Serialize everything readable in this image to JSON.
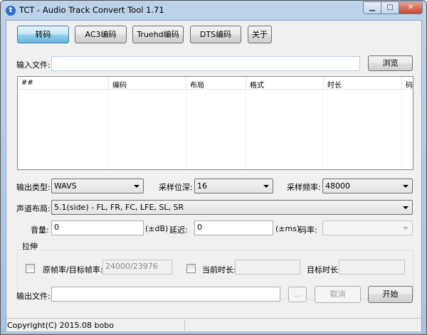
{
  "window": {
    "title": "TCT - Audio Track Convert Tool 1.71",
    "minimize_icon": "minimize-icon",
    "maximize_icon": "maximize-icon",
    "close_icon": "close-icon",
    "app_icon_letter": "t"
  },
  "tabs": [
    {
      "label": "转码",
      "active": true
    },
    {
      "label": "AC3编码"
    },
    {
      "label": "Truehd编码"
    },
    {
      "label": "DTS编码"
    },
    {
      "label": "关于"
    }
  ],
  "input_file": {
    "label": "输入文件:",
    "value": "",
    "browse_label": "浏览"
  },
  "track_table": {
    "columns": [
      "##",
      "编码",
      "布局",
      "格式",
      "时长",
      "码率"
    ],
    "rows": []
  },
  "output_type": {
    "label": "输出类型:",
    "value": "WAVS"
  },
  "bit_depth": {
    "label": "采样位深:",
    "value": "16"
  },
  "sample_rate": {
    "label": "采样频率:",
    "value": "48000"
  },
  "channel_layout": {
    "label": "声道布局:",
    "value": "5.1(side) - FL, FR, FC, LFE, SL, SR"
  },
  "volume": {
    "label": "音量:",
    "value": "0",
    "unit": "(±dB)"
  },
  "delay": {
    "label": "延迟:",
    "value": "0",
    "unit": "(±ms)"
  },
  "bitrate": {
    "label": "码率:",
    "value": ""
  },
  "stretch": {
    "title": "拉伸",
    "framerate_label": "原帧率/目标帧率:",
    "framerate_value": "24000/23976",
    "framerate_checked": false,
    "current_duration_label": "当前时长:",
    "current_duration_checked": false,
    "target_duration_label": "目标时长:"
  },
  "output_file": {
    "label": "输出文件:",
    "value": "",
    "browse_label": "...",
    "cancel_label": "取消",
    "start_label": "开始"
  },
  "status": {
    "text": "Copyright(C) 2015.08 bobo"
  },
  "colors": {
    "active_tab": "#98d1ef",
    "title_bar": "#bcd3ea"
  }
}
